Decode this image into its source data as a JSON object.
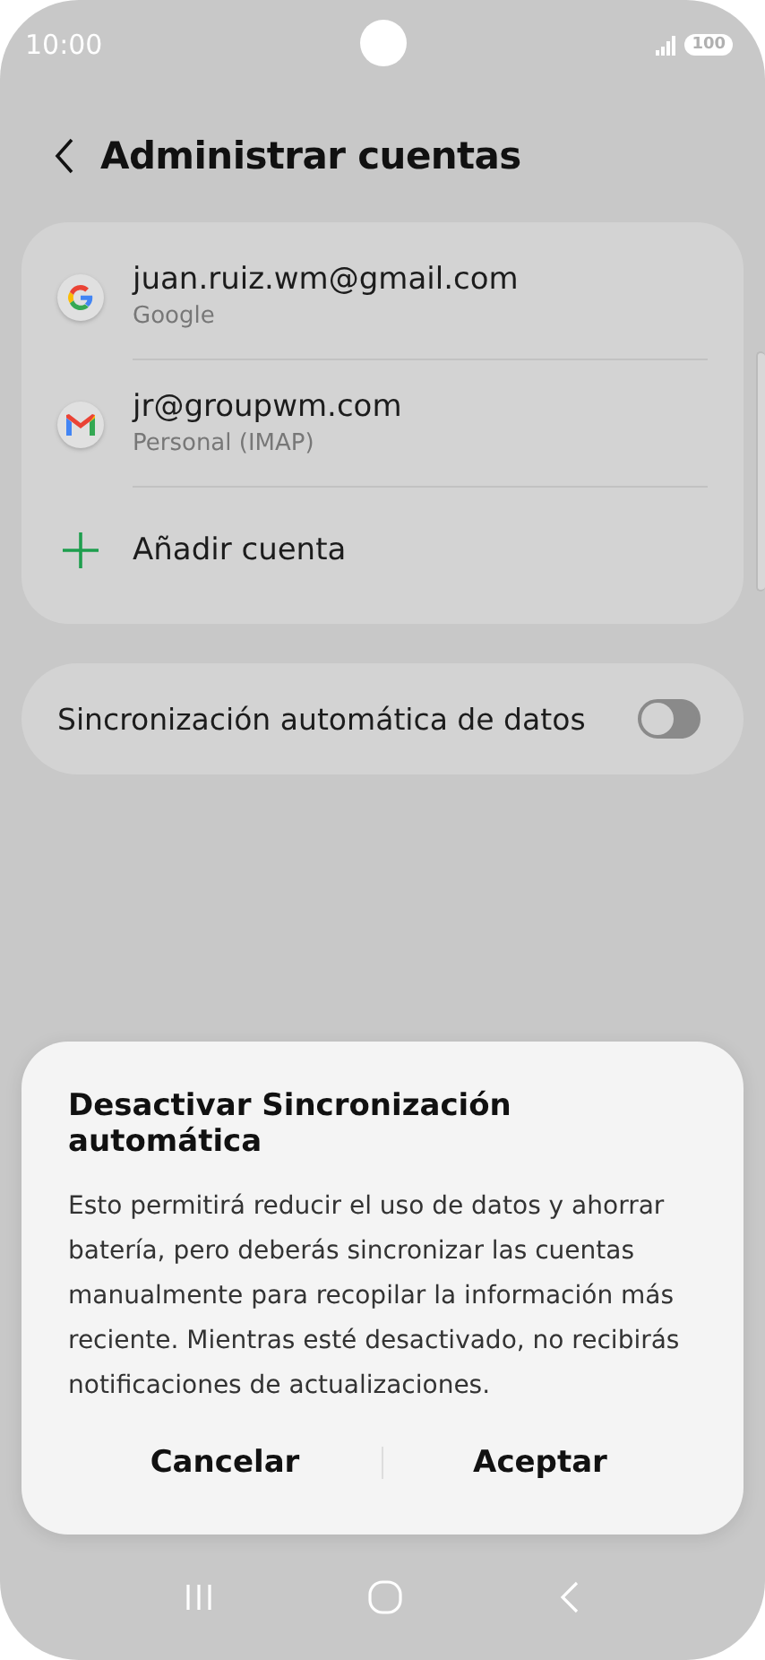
{
  "status_bar": {
    "time": "10:00",
    "battery": "100"
  },
  "header": {
    "title": "Administrar cuentas"
  },
  "accounts": [
    {
      "kind": "google",
      "title": "juan.ruiz.wm@gmail.com",
      "subtitle": "Google"
    },
    {
      "kind": "gmail",
      "title": "jr@groupwm.com",
      "subtitle": "Personal (IMAP)"
    },
    {
      "kind": "add",
      "title": "Añadir cuenta"
    }
  ],
  "sync_setting": {
    "label": "Sincronización automática de datos",
    "on": false
  },
  "dialog": {
    "title": "Desactivar Sincronización automática",
    "message": "Esto permitirá reducir el uso de datos y ahorrar batería, pero deberás sincronizar las cuentas manualmente para recopilar la información más reciente. Mientras esté desactivado, no recibirás notificaciones de actualizaciones.",
    "buttons": [
      "Cancelar",
      "Aceptar"
    ]
  }
}
